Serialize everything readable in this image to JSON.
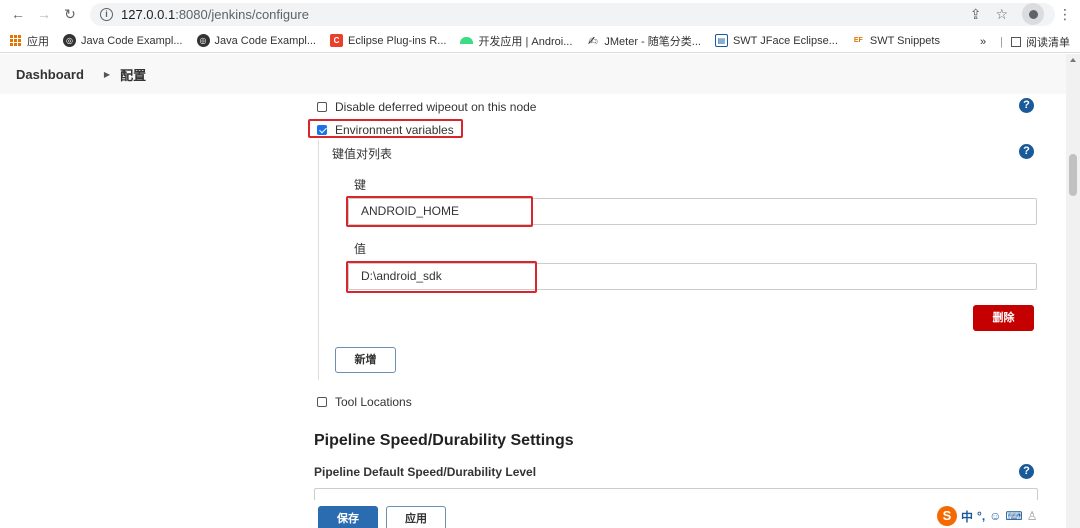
{
  "browser": {
    "url_host": "127.0.0.1",
    "url_rest": ":8080/jenkins/configure",
    "bookmarks": [
      {
        "label": "应用",
        "icon": "apps-grid-icon",
        "color": "#e37400"
      },
      {
        "label": "Java Code Exampl...",
        "icon": "globe-icon",
        "color": "#333333"
      },
      {
        "label": "Java Code Exampl...",
        "icon": "globe-icon",
        "color": "#333333"
      },
      {
        "label": "Eclipse Plug-ins R...",
        "icon": "c-logo-icon",
        "color": "#e8402a"
      },
      {
        "label": "开发应用 | Androi...",
        "icon": "android-icon",
        "color": "#3ddc84"
      },
      {
        "label": "JMeter - 随笔分类...",
        "icon": "pen-icon",
        "color": "#333333"
      },
      {
        "label": "SWT JFace Eclipse...",
        "icon": "book-icon",
        "color": "#1a5a9a"
      },
      {
        "label": "SWT Snippets",
        "icon": "ef-logo-icon",
        "color": "#e37400"
      }
    ],
    "more_label": "»",
    "reading_list": "阅读清单"
  },
  "breadcrumb": {
    "root": "Dashboard",
    "current": "配置"
  },
  "form": {
    "disable_wipeout_label": "Disable deferred wipeout on this node",
    "env_vars_label": "Environment variables",
    "kv_list_label": "键值对列表",
    "key_label": "键",
    "key_value": "ANDROID_HOME",
    "value_label": "值",
    "value_value": "D:\\android_sdk",
    "delete_label": "删除",
    "add_label": "新增",
    "tool_locations_label": "Tool Locations",
    "pipeline_section_title": "Pipeline Speed/Durability Settings",
    "pipeline_level_label": "Pipeline Default Speed/Durability Level",
    "help_glyph": "?"
  },
  "footer": {
    "save_label": "保存",
    "apply_label": "应用"
  },
  "ime": {
    "logo": "S",
    "mode": "中"
  }
}
